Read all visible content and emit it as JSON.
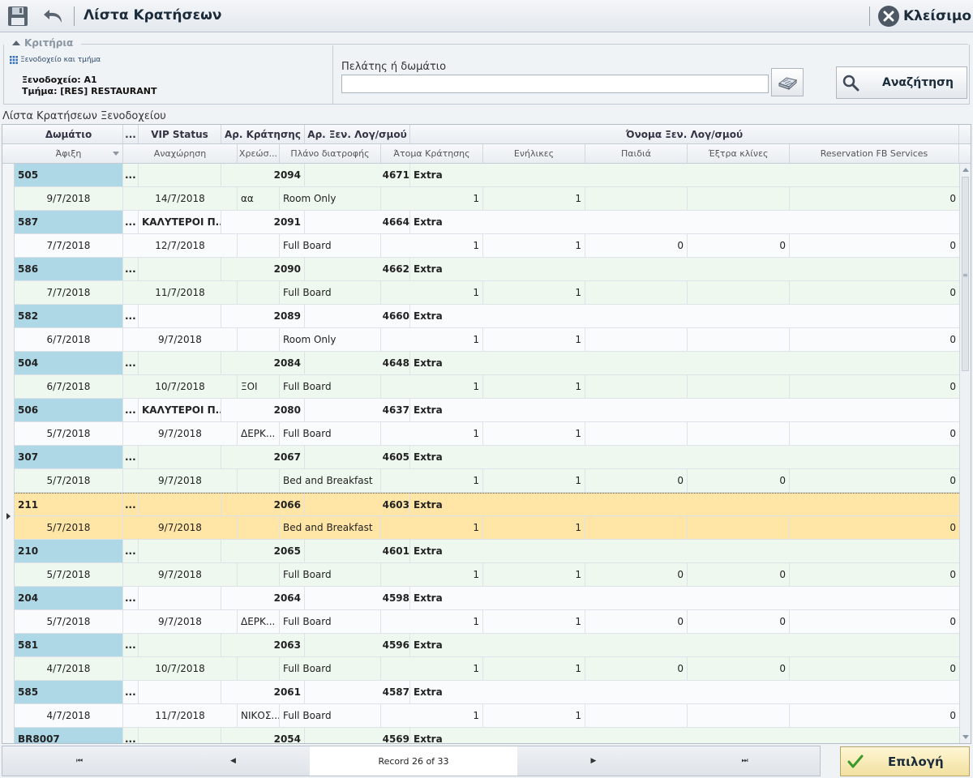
{
  "window": {
    "title": "Λίστα Κρατήσεων",
    "close_label": "Κλείσιμο",
    "icons": {
      "save": "save-disk-icon",
      "undo": "undo-arrow-icon",
      "close": "close-circle-icon"
    }
  },
  "criteria": {
    "legend": "Κριτήρια",
    "hotel_section_link": "Ξενοδοχείο και τμήμα",
    "hotel_line": "Ξενοδοχείο: A1",
    "department_line": "Τμήμα: [RES] RESTAURANT",
    "customer_label": "Πελάτης ή δωμάτιο",
    "customer_value": "",
    "search_label": "Αναζήτηση"
  },
  "grid": {
    "title": "Λίστα Κρατήσεων Ξενοδοχείου",
    "header_row1": [
      "Δωμάτιο",
      "...",
      "VIP Status",
      "Αρ. Κράτησης",
      "Αρ. Ξεν. Λογ/σμού",
      "Όνομα Ξεν. Λογ/σμού"
    ],
    "header_row2": [
      "Άφιξη",
      "Αναχώρηση",
      "Χρεώσ...",
      "Πλάνο διατροφής",
      "Άτομα Κράτησης",
      "Ενήλικες",
      "Παιδιά",
      "Έξτρα κλίνες",
      "Reservation FB Services"
    ],
    "records": [
      {
        "room": "505",
        "vip": "",
        "res_no": "2094",
        "acc_no": "4671",
        "acc_name": "Extra",
        "arrival": "9/7/2018",
        "departure": "14/7/2018",
        "charge": "αα",
        "meal": "Room Only",
        "persons": "1",
        "adults": "1",
        "children": "",
        "extra_beds": "",
        "fb": "0"
      },
      {
        "room": "587",
        "vip": "ΚΑΛΥΤΕΡΟΙ Π...",
        "res_no": "2091",
        "acc_no": "4664",
        "acc_name": "Extra",
        "arrival": "7/7/2018",
        "departure": "12/7/2018",
        "charge": "",
        "meal": "Full Board",
        "persons": "1",
        "adults": "1",
        "children": "0",
        "extra_beds": "0",
        "fb": "0"
      },
      {
        "room": "586",
        "vip": "",
        "res_no": "2090",
        "acc_no": "4662",
        "acc_name": "Extra",
        "arrival": "7/7/2018",
        "departure": "11/7/2018",
        "charge": "",
        "meal": "Full Board",
        "persons": "1",
        "adults": "1",
        "children": "",
        "extra_beds": "",
        "fb": "0"
      },
      {
        "room": "582",
        "vip": "",
        "res_no": "2089",
        "acc_no": "4660",
        "acc_name": "Extra",
        "arrival": "6/7/2018",
        "departure": "9/7/2018",
        "charge": "",
        "meal": "Room Only",
        "persons": "1",
        "adults": "1",
        "children": "",
        "extra_beds": "",
        "fb": "0"
      },
      {
        "room": "504",
        "vip": "",
        "res_no": "2084",
        "acc_no": "4648",
        "acc_name": "Extra",
        "arrival": "6/7/2018",
        "departure": "10/7/2018",
        "charge": "ΞΟΙ",
        "meal": "Full Board",
        "persons": "1",
        "adults": "1",
        "children": "",
        "extra_beds": "",
        "fb": "0"
      },
      {
        "room": "506",
        "vip": "ΚΑΛΥΤΕΡΟΙ Π...",
        "res_no": "2080",
        "acc_no": "4637",
        "acc_name": "Extra",
        "arrival": "5/7/2018",
        "departure": "9/7/2018",
        "charge": "ΔΕΡΚ...",
        "meal": "Full Board",
        "persons": "1",
        "adults": "1",
        "children": "",
        "extra_beds": "",
        "fb": "0"
      },
      {
        "room": "307",
        "vip": "",
        "res_no": "2067",
        "acc_no": "4605",
        "acc_name": "Extra",
        "arrival": "5/7/2018",
        "departure": "9/7/2018",
        "charge": "",
        "meal": "Bed and Breakfast",
        "persons": "1",
        "adults": "1",
        "children": "0",
        "extra_beds": "0",
        "fb": "0"
      },
      {
        "room": "211",
        "vip": "",
        "res_no": "2066",
        "acc_no": "4603",
        "acc_name": "Extra",
        "arrival": "5/7/2018",
        "departure": "9/7/2018",
        "charge": "",
        "meal": "Bed and Breakfast",
        "persons": "1",
        "adults": "1",
        "children": "",
        "extra_beds": "",
        "fb": "0",
        "selected": true
      },
      {
        "room": "210",
        "vip": "",
        "res_no": "2065",
        "acc_no": "4601",
        "acc_name": "Extra",
        "arrival": "5/7/2018",
        "departure": "9/7/2018",
        "charge": "",
        "meal": "Full Board",
        "persons": "1",
        "adults": "1",
        "children": "0",
        "extra_beds": "0",
        "fb": "0"
      },
      {
        "room": "204",
        "vip": "",
        "res_no": "2064",
        "acc_no": "4598",
        "acc_name": "Extra",
        "arrival": "5/7/2018",
        "departure": "9/7/2018",
        "charge": "ΔΕΡΚ...",
        "meal": "Full Board",
        "persons": "1",
        "adults": "1",
        "children": "0",
        "extra_beds": "0",
        "fb": "0"
      },
      {
        "room": "581",
        "vip": "",
        "res_no": "2063",
        "acc_no": "4596",
        "acc_name": "Extra",
        "arrival": "4/7/2018",
        "departure": "10/7/2018",
        "charge": "",
        "meal": "Full Board",
        "persons": "1",
        "adults": "1",
        "children": "0",
        "extra_beds": "0",
        "fb": "0"
      },
      {
        "room": "585",
        "vip": "",
        "res_no": "2061",
        "acc_no": "4587",
        "acc_name": "Extra",
        "arrival": "4/7/2018",
        "departure": "11/7/2018",
        "charge": "ΝΙΚΟΣ...",
        "meal": "Full Board",
        "persons": "1",
        "adults": "1",
        "children": "",
        "extra_beds": "",
        "fb": "0"
      },
      {
        "room": "BR8007",
        "vip": "",
        "res_no": "2054",
        "acc_no": "4569",
        "acc_name": "Extra",
        "arrival": "",
        "departure": "",
        "charge": "",
        "meal": "",
        "persons": "",
        "adults": "",
        "children": "",
        "extra_beds": "",
        "fb": ""
      }
    ]
  },
  "footer": {
    "record_info": "Record 26 of 33",
    "nav_first": "⏮",
    "nav_prev": "◀",
    "nav_next": "▶",
    "nav_last": "⏭",
    "select_label": "Επιλογή"
  },
  "colors": {
    "room_cell": "#aed8e6",
    "selected_row": "#ffe6a6",
    "alt_row": "#eef8ee"
  }
}
